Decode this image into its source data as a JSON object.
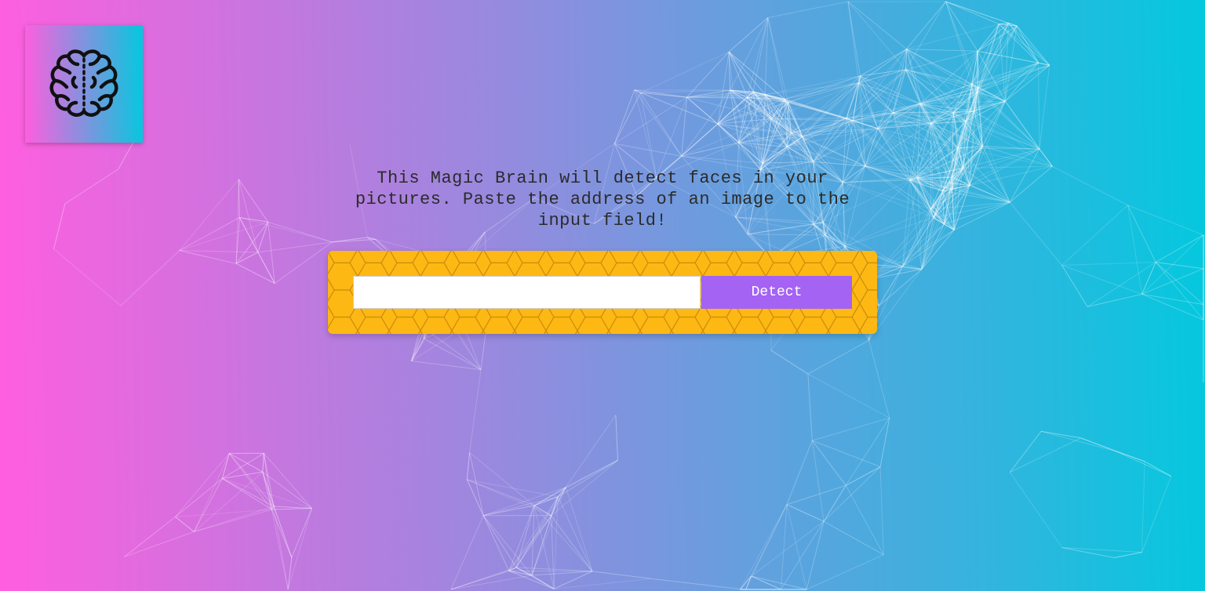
{
  "logo": {
    "icon": "brain-icon"
  },
  "intro": {
    "text": "This Magic Brain will detect faces in your pictures. Paste the address of an image to the input field!"
  },
  "form": {
    "input_value": "",
    "input_placeholder": "",
    "detect_label": "Detect"
  },
  "colors": {
    "gradient_start": "#ff5edf",
    "gradient_end": "#04c8de",
    "panel": "#fdb813",
    "button": "#a463f2"
  }
}
